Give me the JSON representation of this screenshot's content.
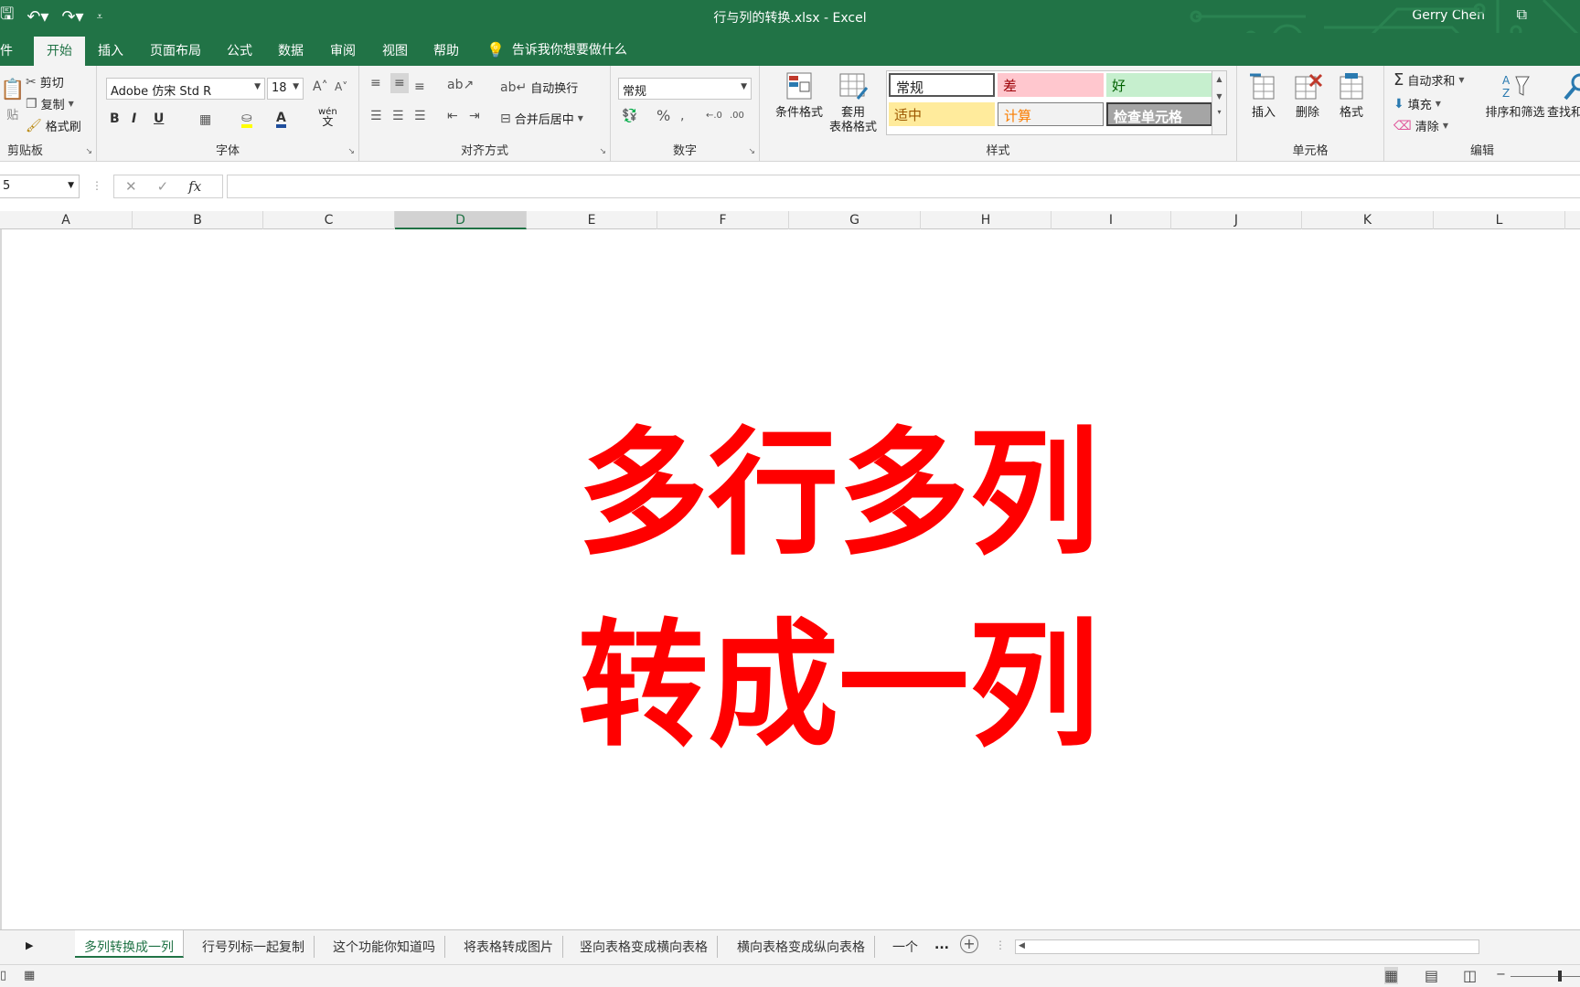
{
  "window": {
    "title": "行与列的转换.xlsx  -  Excel",
    "user": "Gerry Chen"
  },
  "tabs": [
    "件",
    "开始",
    "插入",
    "页面布局",
    "公式",
    "数据",
    "审阅",
    "视图",
    "帮助"
  ],
  "tell_me": "告诉我你想要做什么",
  "clipboard": {
    "cut": "剪切",
    "copy": "复制",
    "format_painter": "格式刷",
    "paste_partial": "贴",
    "label": "剪贴板"
  },
  "font": {
    "name": "Adobe 仿宋 Std R",
    "size": "18",
    "label": "字体",
    "phonetic": "wén",
    "phonetic2": "文"
  },
  "alignment": {
    "wrap": "自动换行",
    "merge": "合并后居中",
    "label": "对齐方式"
  },
  "number": {
    "format": "常规",
    "label": "数字"
  },
  "styles": {
    "conditional": "条件格式",
    "table_line1": "套用",
    "table_line2": "表格格式",
    "label": "样式",
    "normal": "常规",
    "bad": "差",
    "good": "好",
    "neutral": "适中",
    "calculation": "计算",
    "check_cell": "检查单元格"
  },
  "cells": {
    "insert": "插入",
    "delete": "删除",
    "format": "格式",
    "label": "单元格"
  },
  "editing": {
    "autosum": "自动求和",
    "fill": "填充",
    "clear": "清除",
    "sort_filter": "排序和筛选",
    "find": "查找和",
    "label": "编辑"
  },
  "namebox": "5",
  "fx": "fx",
  "columns": [
    "A",
    "B",
    "C",
    "D",
    "E",
    "F",
    "G",
    "H",
    "I",
    "J",
    "K",
    "L"
  ],
  "overlay": {
    "line1": "多行多列",
    "line2": "转成一列"
  },
  "sheets": [
    "多列转换成一列",
    "行号列标一起复制",
    "这个功能你知道吗",
    "将表格转成图片",
    "竖向表格变成横向表格",
    "横向表格变成纵向表格",
    "一个"
  ],
  "sheets_more": "...",
  "colors": {
    "excel_green": "#217346",
    "overlay_red": "#ff0000"
  }
}
